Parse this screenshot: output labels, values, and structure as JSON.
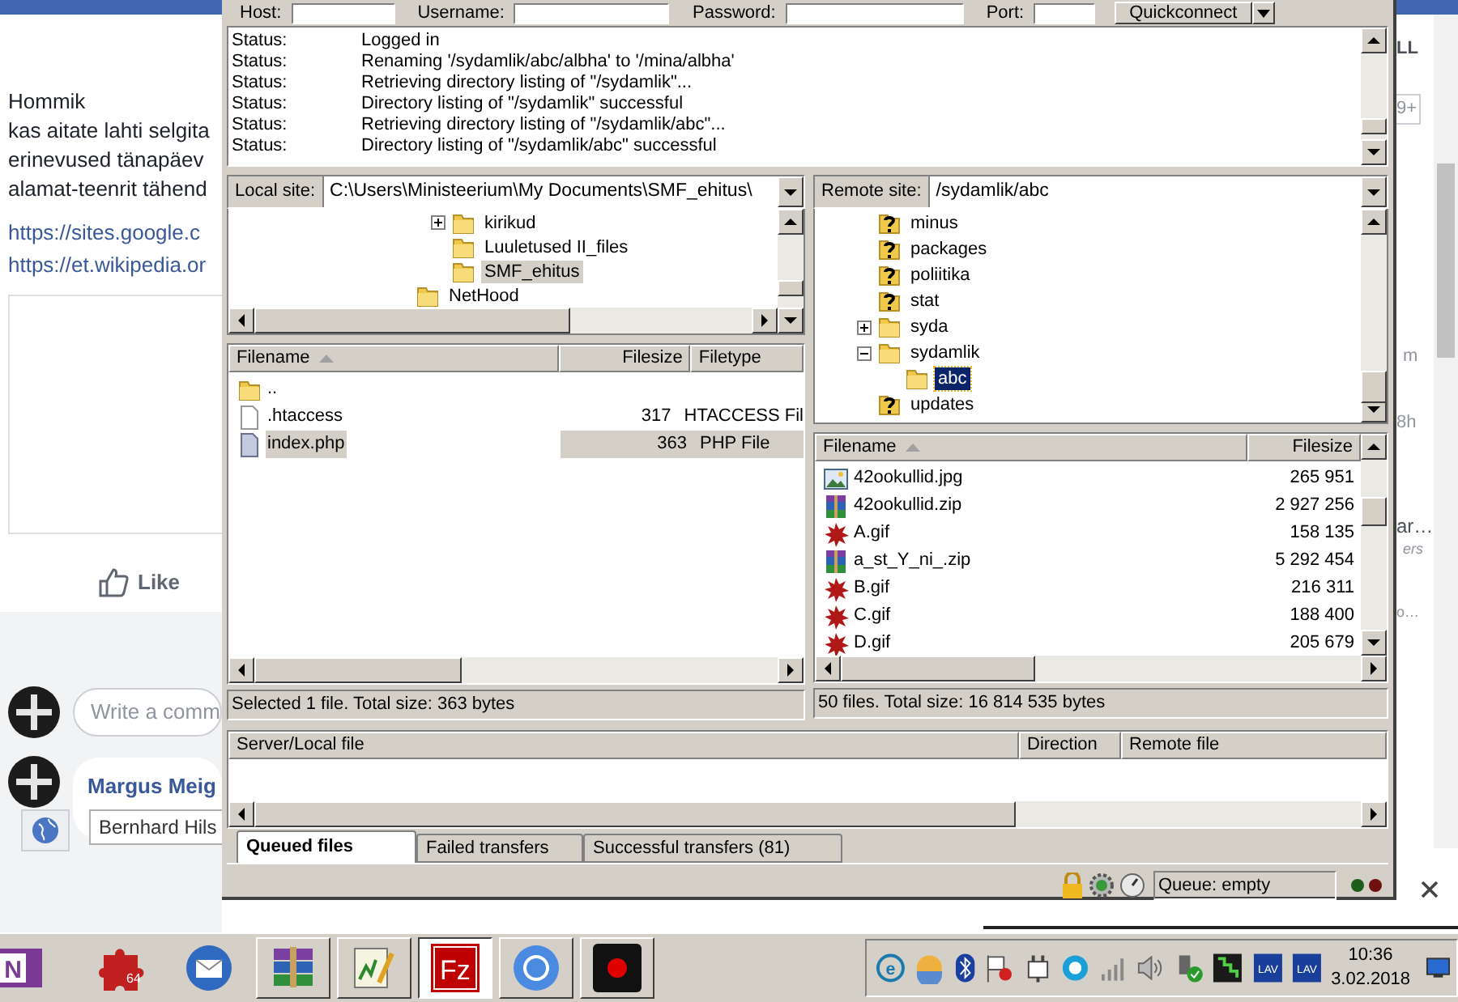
{
  "web_page": {
    "post_lines": [
      "Hommik",
      "kas aitate lahti selgita",
      "erinevused tänapäev",
      "alamat-teenrit tähend"
    ],
    "links": [
      "https://sites.google.c",
      "https://et.wikipedia.or"
    ],
    "like_button": "Like",
    "comment_placeholder": "Write a comm",
    "comment_author": "Margus Meig",
    "tooltip": "Bernhard Hils",
    "side_snippets": [
      "LL",
      "9+",
      "m",
      "8h",
      "ar…",
      "ers",
      "o…"
    ]
  },
  "filezilla": {
    "quickconnect": {
      "fields": [
        {
          "label": "Host:"
        },
        {
          "label": "Username:"
        },
        {
          "label": "Password:"
        },
        {
          "label": "Port:"
        }
      ],
      "button": "Quickconnect"
    },
    "log": [
      {
        "label": "Status:",
        "message": "Logged in"
      },
      {
        "label": "Status:",
        "message": "Renaming '/sydamlik/abc/albha' to '/mina/albha'"
      },
      {
        "label": "Status:",
        "message": "Retrieving directory listing of \"/sydamlik\"..."
      },
      {
        "label": "Status:",
        "message": "Directory listing of \"/sydamlik\" successful"
      },
      {
        "label": "Status:",
        "message": "Retrieving directory listing of \"/sydamlik/abc\"..."
      },
      {
        "label": "Status:",
        "message": "Directory listing of \"/sydamlik/abc\" successful"
      }
    ],
    "local": {
      "site_label": "Local site:",
      "path": "C:\\Users\\Ministeerium\\My Documents\\SMF_ehitus\\",
      "tree": [
        {
          "children": [
            {
              "name": "kirikud",
              "kind": "folder",
              "expanded": false,
              "has_children": true,
              "selected": false
            },
            {
              "name": "Luuletused II_files",
              "kind": "folder",
              "has_children": false,
              "selected": false
            },
            {
              "name": "SMF_ehitus",
              "kind": "folder",
              "has_children": false,
              "selected": true
            }
          ]
        },
        {
          "name": "NetHood",
          "kind": "folder",
          "has_children": false,
          "selected": false
        }
      ],
      "columns": [
        "Filename",
        "Filesize",
        "Filetype"
      ],
      "files": [
        {
          "name": "..",
          "kind": "folder",
          "selected": false
        },
        {
          "name": ".htaccess",
          "size": "317",
          "type": "HTACCESS Fil",
          "kind": "file",
          "selected": false
        },
        {
          "name": "index.php",
          "size": "363",
          "type": "PHP File",
          "kind": "script",
          "selected": true
        }
      ],
      "status": "Selected 1 file. Total size: 363 bytes"
    },
    "remote": {
      "site_label": "Remote site:",
      "path": "/sydamlik/abc",
      "tree": [
        {
          "name": "minus",
          "kind": "unknown",
          "has_children": false,
          "selected": false
        },
        {
          "name": "packages",
          "kind": "unknown",
          "has_children": false,
          "selected": false
        },
        {
          "name": "poliitika",
          "kind": "unknown",
          "has_children": false,
          "selected": false
        },
        {
          "name": "stat",
          "kind": "unknown",
          "has_children": false,
          "selected": false
        },
        {
          "name": "syda",
          "kind": "folder",
          "expanded": false,
          "has_children": true,
          "selected": false
        },
        {
          "name": "sydamlik",
          "kind": "folder",
          "expanded": true,
          "has_children": true,
          "selected": false,
          "children": [
            {
              "name": "abc",
              "kind": "folder",
              "has_children": false,
              "selected": true
            }
          ]
        },
        {
          "name": "updates",
          "kind": "unknown",
          "has_children": false,
          "selected": false
        }
      ],
      "columns": [
        "Filename",
        "Filesize"
      ],
      "files": [
        {
          "name": "42ookullid.jpg",
          "size": "265 951",
          "kind": "image"
        },
        {
          "name": "42ookullid.zip",
          "size": "2 927 256",
          "kind": "archive"
        },
        {
          "name": "A.gif",
          "size": "158 135",
          "kind": "gif"
        },
        {
          "name": "a_st_Y_ni_.zip",
          "size": "5 292 454",
          "kind": "archive"
        },
        {
          "name": "B.gif",
          "size": "216 311",
          "kind": "gif"
        },
        {
          "name": "C.gif",
          "size": "188 400",
          "kind": "gif"
        },
        {
          "name": "D.gif",
          "size": "205 679",
          "kind": "gif"
        }
      ],
      "status": "50 files. Total size: 16 814 535 bytes"
    },
    "queue": {
      "columns": [
        "Server/Local file",
        "Direction",
        "Remote file"
      ]
    },
    "tabs": [
      {
        "label": "Queued files",
        "selected": true
      },
      {
        "label": "Failed transfers",
        "selected": false
      },
      {
        "label": "Successful transfers (81)",
        "selected": false
      }
    ],
    "queue_status": "Queue: empty"
  },
  "taskbar": {
    "apps": [
      {
        "kind": "onenote",
        "text": "N",
        "running": false,
        "selected": false
      },
      {
        "kind": "puzzle",
        "text": "64",
        "running": false,
        "selected": false
      },
      {
        "kind": "mail",
        "running": false,
        "selected": false
      },
      {
        "kind": "archiver",
        "running": true,
        "selected": false
      },
      {
        "kind": "notepad",
        "running": true,
        "selected": false
      },
      {
        "kind": "filezilla",
        "text": "Fz",
        "running": true,
        "selected": true
      },
      {
        "kind": "browser",
        "running": true,
        "selected": false
      },
      {
        "kind": "recorder",
        "running": true,
        "selected": false
      }
    ],
    "tray": [
      {
        "kind": "e",
        "text": "e"
      },
      {
        "kind": "weather"
      },
      {
        "kind": "bluetooth"
      },
      {
        "kind": "flag"
      },
      {
        "kind": "plug"
      },
      {
        "kind": "eye"
      },
      {
        "kind": "signal"
      },
      {
        "kind": "speaker"
      },
      {
        "kind": "usb"
      },
      {
        "kind": "chart"
      },
      {
        "kind": "lav",
        "text": "LAV"
      },
      {
        "kind": "lav",
        "text": "LAV"
      }
    ],
    "time": "10:36",
    "date": "3.02.2018"
  }
}
